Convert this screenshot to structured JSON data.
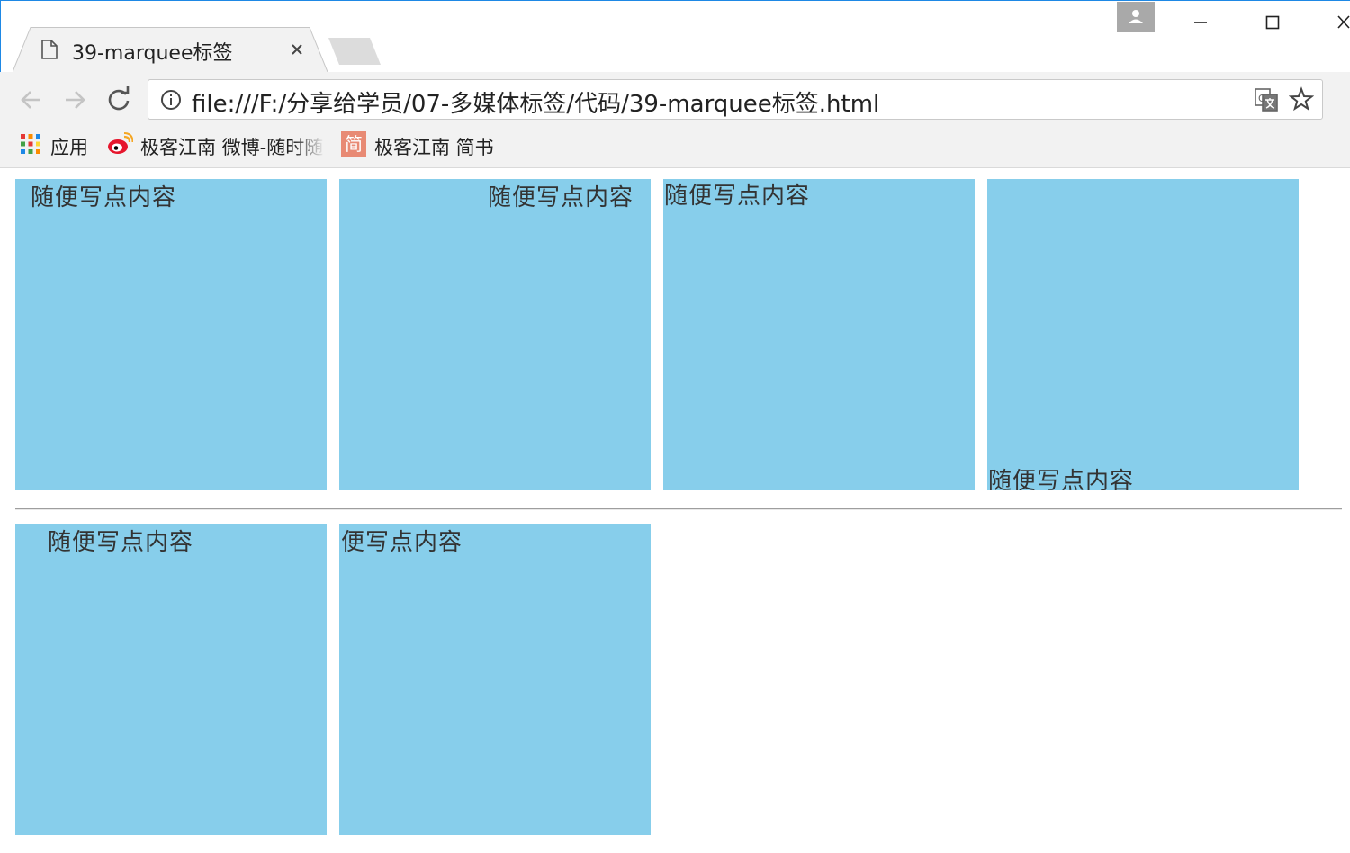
{
  "browser": {
    "tab": {
      "title": "39-marquee标签",
      "icon": "page-icon",
      "close_icon": "close-icon"
    },
    "window_controls": [
      "minimize-icon",
      "maximize-icon",
      "close-icon"
    ],
    "address_bar": {
      "url": "file:///F:/分享给学员/07-多媒体标签/代码/39-marquee标签.html",
      "left_icon": "info-icon",
      "right_icons": [
        "translate-icon",
        "star-icon"
      ]
    },
    "bookmarks": [
      {
        "label": "应用",
        "icon": "apps-grid-icon"
      },
      {
        "label": "极客江南 微博-随时随",
        "icon": "weibo-icon"
      },
      {
        "label": "极客江南 简书",
        "icon": "jianshu-icon",
        "icon_text": "简"
      }
    ]
  },
  "page": {
    "marquees": [
      {
        "text": "随便写点内容"
      },
      {
        "text": "随便写点内容"
      },
      {
        "text": "随便写点内容"
      },
      {
        "text": "随便写点内容"
      },
      {
        "text": "随便写点内容"
      },
      {
        "text": "便写点内容"
      }
    ],
    "box_color": "#87ceeb"
  }
}
